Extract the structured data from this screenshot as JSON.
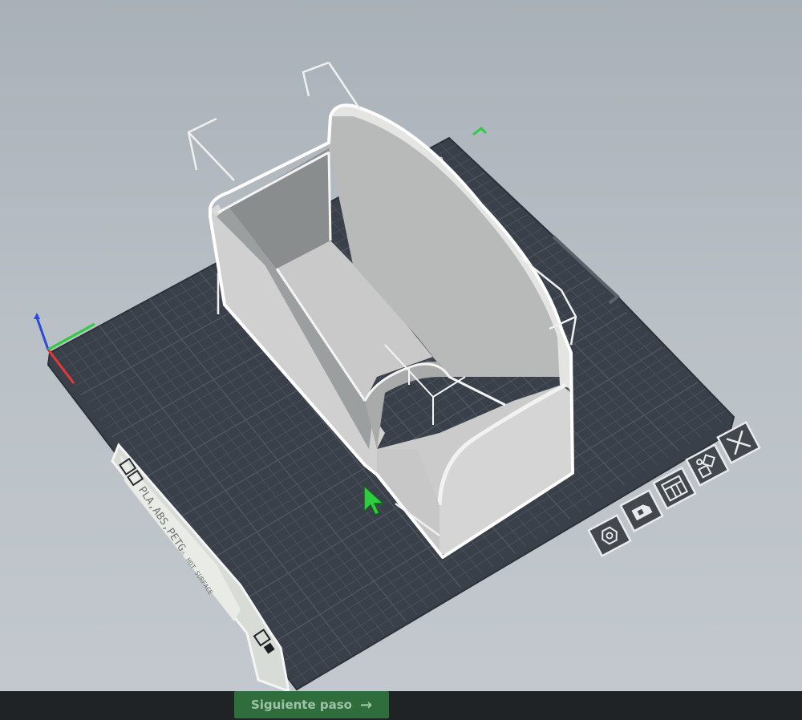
{
  "viewport": {
    "bed_color": "#3a4049",
    "grid_color": "#4f5660",
    "model_color": "#d6d7d6",
    "outline_color": "#ffffff",
    "cursor_color": "#2ecc40",
    "axis_colors": {
      "x": "#e53935",
      "y": "#2ecc40",
      "z": "#2a4bdd"
    }
  },
  "material_panel": {
    "icon_name": "material-icon",
    "material_label": "PLA,ABS,PETG",
    "warning_icon": "warning-icon",
    "warning_label": "HOT SURFACE"
  },
  "toolbar": {
    "items": [
      {
        "name": "settings-tool-button",
        "icon": "hex-nut-icon"
      },
      {
        "name": "support-tool-button",
        "icon": "support-icon"
      },
      {
        "name": "layout-tool-button",
        "icon": "layout-grid-icon"
      },
      {
        "name": "arrange-tool-button",
        "icon": "arrange-icon"
      },
      {
        "name": "close-tool-button",
        "icon": "close-icon"
      }
    ]
  },
  "footer": {
    "next_label": "Siguiente paso",
    "next_icon": "arrow-right-icon",
    "button_color": "#2f6d3c"
  }
}
